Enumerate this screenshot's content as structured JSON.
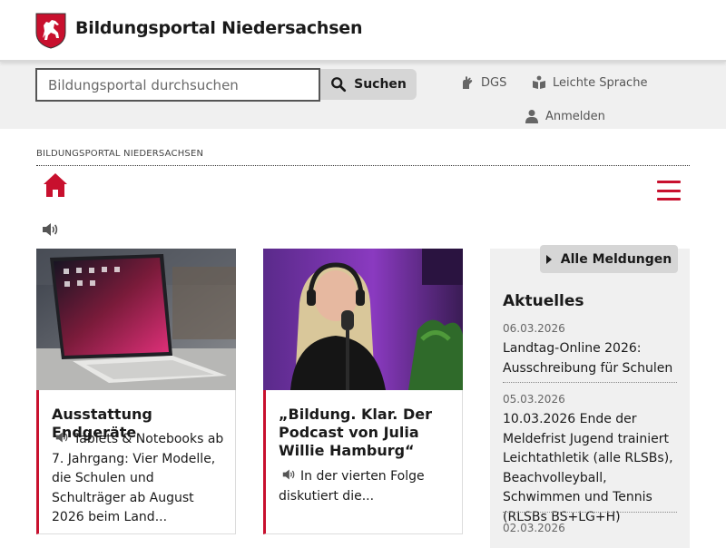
{
  "header": {
    "logo_name": "lower-saxony-horse-shield",
    "title": "Bildungsportal Niedersachsen"
  },
  "toolbar": {
    "search_placeholder": "Bildungsportal durchsuchen",
    "search_label": "Suchen",
    "dgs_label": "DGS",
    "easy_language_label": "Leichte Sprache",
    "login_label": "Anmelden"
  },
  "breadcrumb": "BILDUNGSPORTAL NIEDERSACHSEN",
  "colors": {
    "accent": "#c8102e",
    "toolbar_bg": "#f0f0f0",
    "button_bg": "#d6d6d6"
  },
  "cards": [
    {
      "title": "Ausstattung Endgeräte",
      "teaser": "Tablets & Notebooks ab 7. Jahrgang: Vier Modelle, die Schulen und Schulträger ab August 2026 beim Land..."
    },
    {
      "title": "„Bildung. Klar. Der Podcast von Julia Willie Hamburg“",
      "teaser": "In der vierten Folge diskutiert die..."
    }
  ],
  "news": {
    "all_label": "Alle Meldungen",
    "heading": "Aktuelles",
    "items": [
      {
        "date": "06.03.2026",
        "text": "Landtag-Online 2026: Ausschreibung für Schulen"
      },
      {
        "date": "05.03.2026",
        "text": "10.03.2026 Ende der Meldefrist Jugend trainiert Leichtathletik (alle RLSBs), Beachvolleyball, Schwimmen und Tennis (RLSBs BS+LG+H)"
      },
      {
        "date": "02.03.2026",
        "text": ""
      }
    ]
  }
}
